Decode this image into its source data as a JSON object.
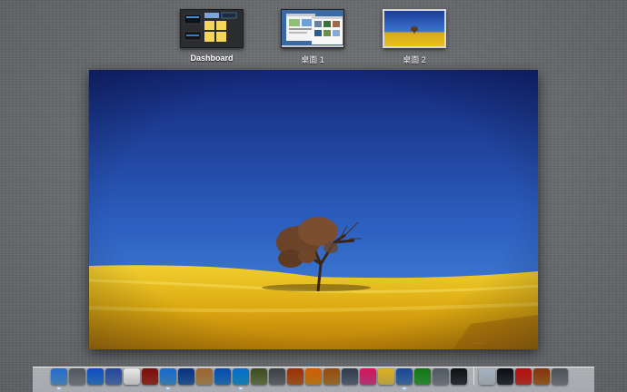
{
  "spaces": [
    {
      "label": "Dashboard",
      "kind": "dashboard"
    },
    {
      "label": "桌面 1",
      "kind": "desktop"
    },
    {
      "label": "桌面 2",
      "kind": "desktop",
      "selected": true
    }
  ],
  "wallpaper": {
    "name": "yellow-field-tree",
    "sky_top": "#14287a",
    "sky_bottom": "#3f80d8",
    "field": "#e8b81c"
  },
  "dock": {
    "apps": [
      {
        "name": "finder-icon",
        "color": "#5fa6e8",
        "running": true
      },
      {
        "name": "launchpad-icon",
        "color": "#8f959c",
        "running": false
      },
      {
        "name": "app-store-icon",
        "color": "#3a8de0",
        "running": false
      },
      {
        "name": "preview-icon",
        "color": "#5b86c9",
        "running": false
      },
      {
        "name": "calendar-icon",
        "color": "#f4f4f4",
        "running": false
      },
      {
        "name": "dictionary-icon",
        "color": "#b23a2e",
        "running": false
      },
      {
        "name": "safari-icon",
        "color": "#4aa3e6",
        "running": true
      },
      {
        "name": "mail-icon",
        "color": "#2e6fb7",
        "running": false
      },
      {
        "name": "notes-paper-icon",
        "color": "#c9a066",
        "running": false
      },
      {
        "name": "itunes-icon",
        "color": "#2c8ad6",
        "running": false
      },
      {
        "name": "skype-icon",
        "color": "#1fa7e4",
        "running": true
      },
      {
        "name": "iphoto-icon",
        "color": "#7b8c5a",
        "running": false
      },
      {
        "name": "image-capture-icon",
        "color": "#7a7f86",
        "running": false
      },
      {
        "name": "guitar-icon",
        "color": "#c96b2b",
        "running": false
      },
      {
        "name": "media-player-icon",
        "color": "#e79a1e",
        "running": false
      },
      {
        "name": "package-icon",
        "color": "#c48a3b",
        "running": false
      },
      {
        "name": "photo-viewer-icon",
        "color": "#6d7a8c",
        "running": false
      },
      {
        "name": "music-icon",
        "color": "#e8489a",
        "running": false
      },
      {
        "name": "stickies-icon",
        "color": "#efd35a",
        "running": false
      },
      {
        "name": "xcode-icon",
        "color": "#4f86c5",
        "running": true
      },
      {
        "name": "evernote-icon",
        "color": "#3fae45",
        "running": false
      },
      {
        "name": "screen-sharing-icon",
        "color": "#8e969e",
        "running": false
      },
      {
        "name": "terminal-icon",
        "color": "#3b3f45",
        "running": false
      }
    ],
    "stacks": [
      {
        "name": "printer-icon",
        "color": "#cdd5de"
      },
      {
        "name": "iphone-icon",
        "color": "#333a44"
      },
      {
        "name": "close-red-icon",
        "color": "#d93a33"
      },
      {
        "name": "downloads-stack-icon",
        "color": "#b9732f"
      },
      {
        "name": "trash-icon",
        "color": "#8b9096"
      }
    ]
  }
}
